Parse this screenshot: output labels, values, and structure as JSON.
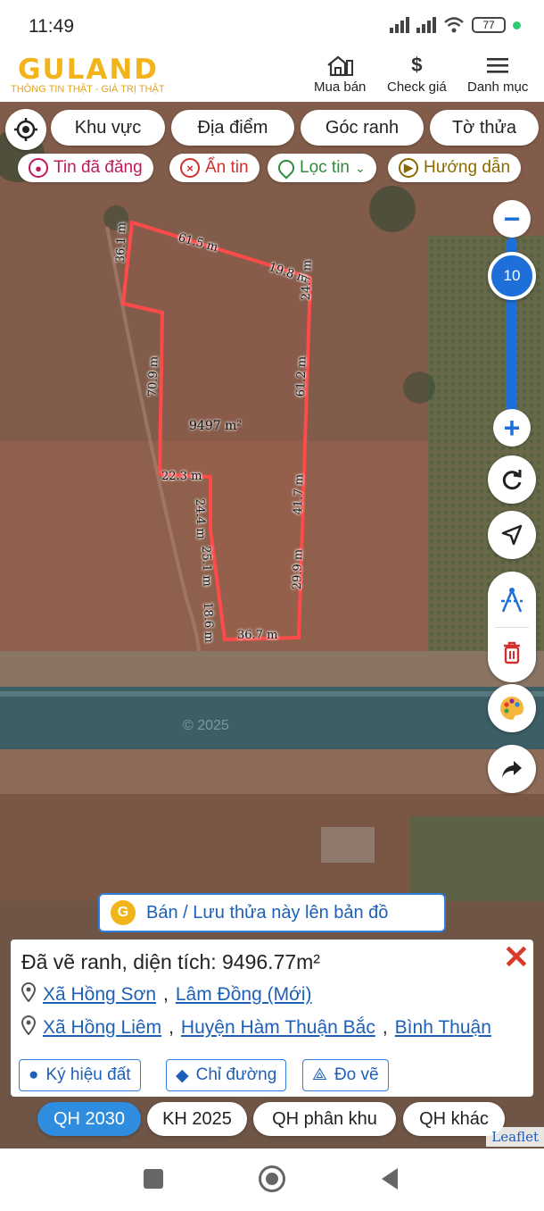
{
  "status": {
    "time": "11:49",
    "battery": "77"
  },
  "header": {
    "logo": "GULAND",
    "slogan": "THÔNG TIN THẬT - GIÁ TRỊ THẬT",
    "nav": [
      {
        "label": "Mua bán",
        "icon": "house-icon"
      },
      {
        "label": "Check giá",
        "icon": "dollar-icon"
      },
      {
        "label": "Danh mục",
        "icon": "menu-icon"
      }
    ]
  },
  "filters": {
    "row1": [
      "Khu vực",
      "Địa điểm",
      "Góc ranh",
      "Tờ thửa"
    ],
    "row2": [
      {
        "label": "Tin đã đăng",
        "color": "#c0185b"
      },
      {
        "label": "Ẩn tin",
        "color": "#d32f2f"
      },
      {
        "label": "Lọc tin",
        "color": "#2e8b3a"
      },
      {
        "label": "Hướng dẫn",
        "color": "#8a6a00"
      }
    ]
  },
  "map": {
    "zoom_level": "10",
    "plot_area": "9497 m²",
    "edges": [
      "61.5 m",
      "19.8 m",
      "36.1 m",
      "24.7 m",
      "70.9 m",
      "61.2 m",
      "22.3 m",
      "24.4 m",
      "25.1 m",
      "41.7 m",
      "18.6 m",
      "29.9 m",
      "36.7 m"
    ],
    "watermark": "© 2025"
  },
  "banner": {
    "label": "Bán / Lưu thửa này lên bản đồ"
  },
  "info": {
    "title": "Đã vẽ ranh, diện tích: 9496.77m²",
    "address1": {
      "commune": "Xã Hồng Sơn",
      "province": "Lâm Đồng (Mới)"
    },
    "address2": {
      "commune": "Xã Hồng Liêm",
      "district": "Huyện Hàm Thuận Bắc",
      "province": "Bình Thuận"
    },
    "buttons": [
      "Ký hiệu đất",
      "Chỉ đường",
      "Đo vẽ"
    ]
  },
  "layers": [
    "QH 2030",
    "KH 2025",
    "QH phân khu",
    "QH khác"
  ],
  "attribution": "Leaflet",
  "colors": {
    "accent": "#2f8de0",
    "boundary": "#ff4a4a",
    "logo": "#f2b41b"
  }
}
